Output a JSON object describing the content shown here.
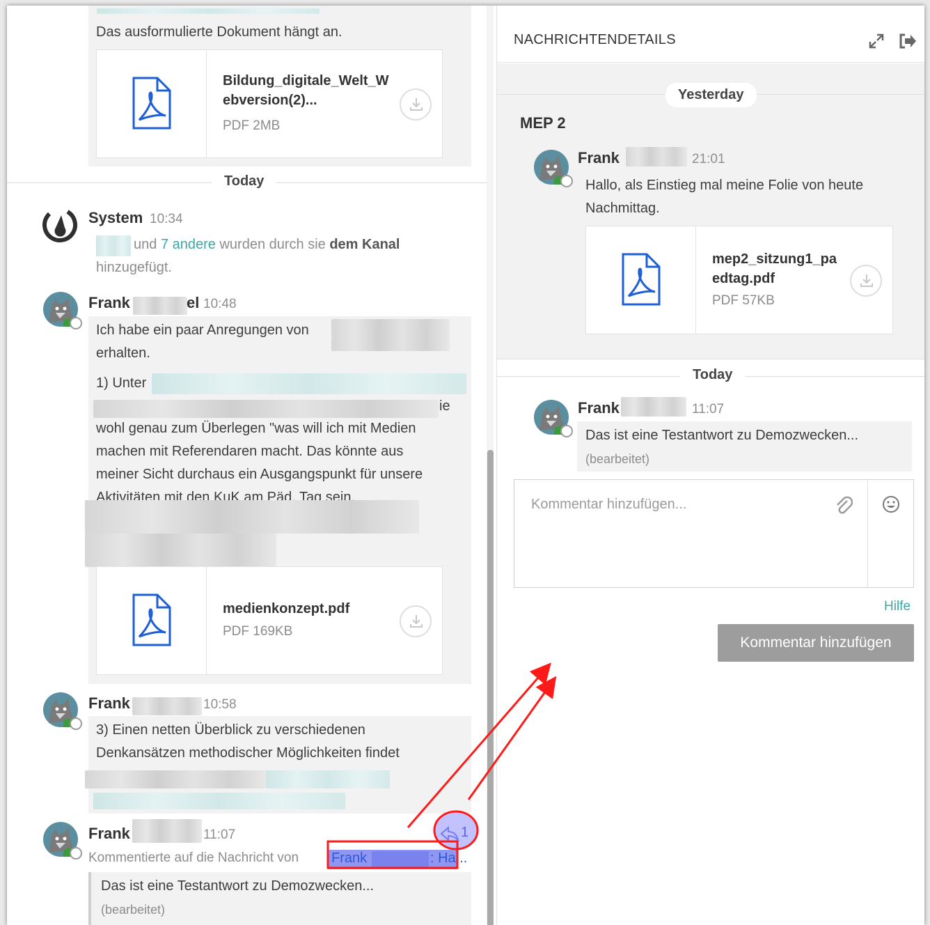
{
  "left": {
    "top_message": {
      "text": "Das ausformulierte Dokument hängt an.",
      "attachment": {
        "name_line1": "Bildung_digitale_Welt_W",
        "name_line2": "ebversion(2)...",
        "meta": "PDF 2MB"
      }
    },
    "separator_today": "Today",
    "system_post": {
      "user": "System",
      "time": "10:34",
      "and": "und",
      "others_link": "7 andere",
      "middle": "wurden durch sie",
      "channel": "dem Kanal",
      "line2": "hinzugefügt."
    },
    "post1": {
      "user": "Frank",
      "user_tail": "el",
      "time": "10:48",
      "line1": "Ich habe ein paar Anregungen von",
      "line2": "erhalten.",
      "line3": "1) Unter",
      "line4_tail": "ie",
      "line5": "wohl genau zum Überlegen \"was will ich mit Medien",
      "line6": "machen mit Referendaren macht. Das könnte aus",
      "line7": "meiner Sicht durchaus ein Ausgangspunkt für unsere",
      "line8": "Aktivitäten mit den KuK am Päd. Tag sein.",
      "attachment": {
        "name_line1": "medienkonzept.pdf",
        "meta": "PDF 169KB"
      }
    },
    "post2": {
      "user": "Frank",
      "time": "10:58",
      "line1": "3) Einen netten Überblick zu verschiedenen",
      "line2": "Denkansätzen methodischer Möglichkeiten findet"
    },
    "post3": {
      "user": "Frank",
      "time": "11:07",
      "commented_prefix": "Kommentierte auf die Nachricht von",
      "commented_user": "Frank",
      "commented_tail": ": Ha...",
      "reply_count": "1",
      "text": "Das ist eine Testantwort zu Demozwecken...",
      "edited": "(bearbeitet)"
    }
  },
  "rhs": {
    "title": "NACHRICHTENDETAILS",
    "separator_yesterday": "Yesterday",
    "channel": "MEP 2",
    "root_post": {
      "user": "Frank",
      "time": "21:01",
      "line1": "Hallo, als Einstieg mal meine Folie von heute",
      "line2": "Nachmittag.",
      "attachment": {
        "name_line1": "mep2_sitzung1_pa",
        "name_line2": "edtag.pdf",
        "meta": "PDF 57KB"
      }
    },
    "separator_today": "Today",
    "reply": {
      "user": "Frank",
      "time": "11:07",
      "text": "Das ist eine Testantwort zu Demozwecken...",
      "edited": "(bearbeitet)"
    },
    "comment_placeholder": "Kommentar hinzufügen...",
    "help": "Hilfe",
    "submit": "Kommentar hinzufügen"
  },
  "icons": [
    "pdf-icon",
    "download-icon",
    "system-logo-icon",
    "avatar-wolf-icon",
    "expand-icon",
    "close-panel-icon",
    "attach-icon",
    "emoji-icon",
    "reply-arrow-icon"
  ],
  "colors": {
    "link": "#3fa6a6",
    "pdf_blue": "#1e5fd6",
    "annotation_red": "#ff1a1a",
    "reply_highlight": "#7f86f0"
  }
}
